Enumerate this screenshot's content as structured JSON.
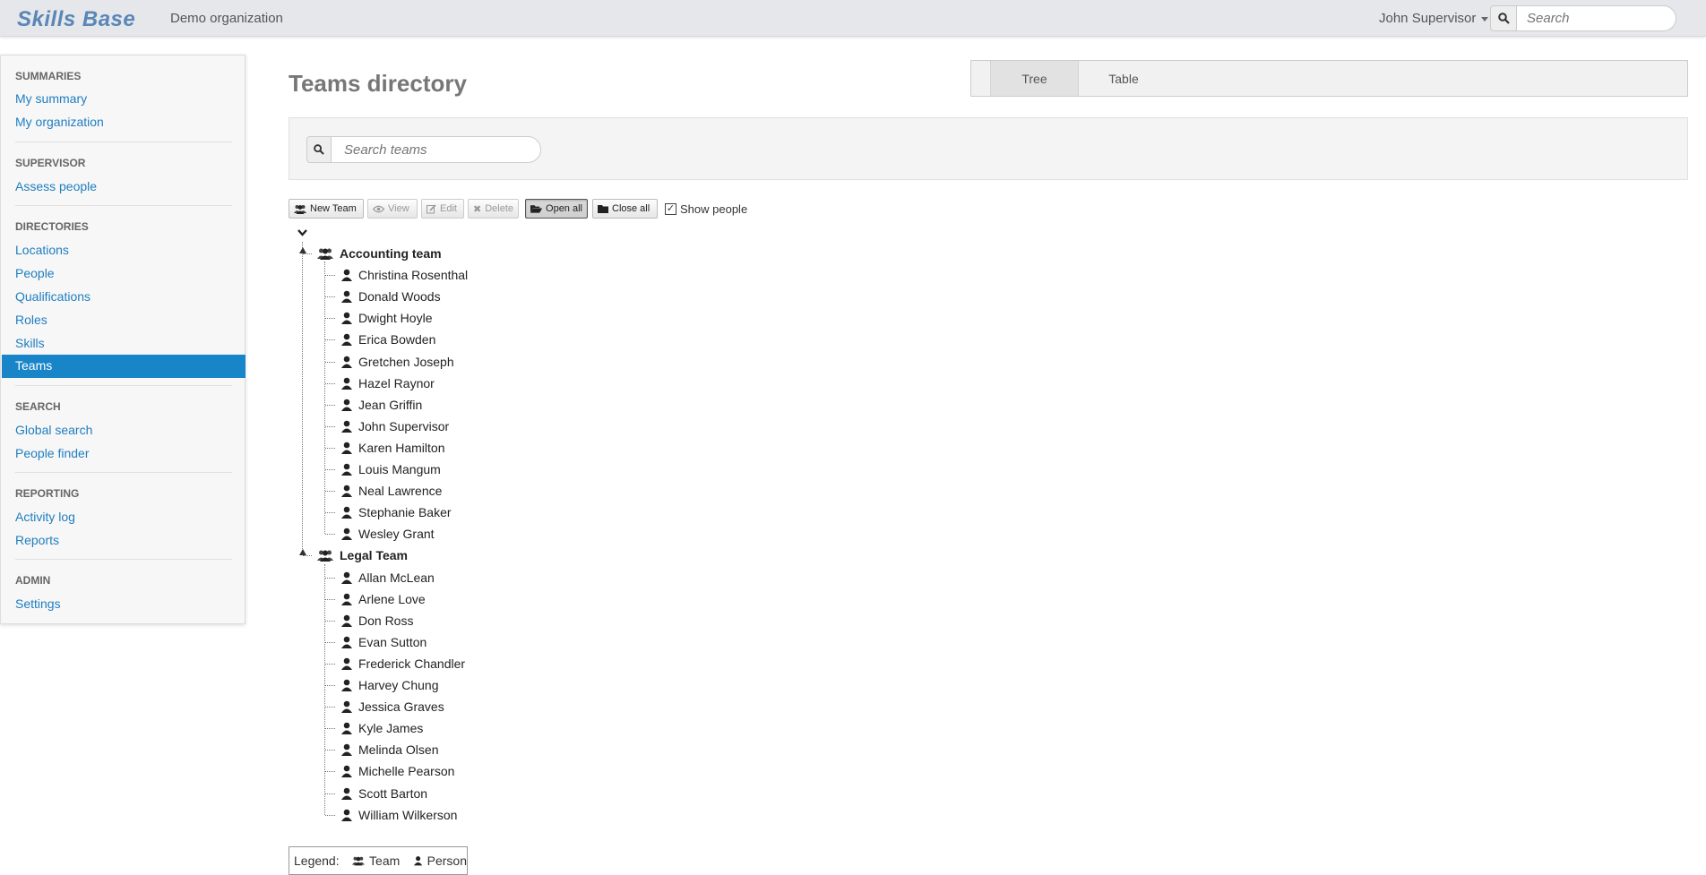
{
  "app": {
    "brand": "Skills Base",
    "org": "Demo organization"
  },
  "topbar": {
    "user": "John Supervisor",
    "search_placeholder": "Search"
  },
  "sidebar": {
    "sections": [
      {
        "heading": "Summaries",
        "items": [
          "My summary",
          "My organization"
        ]
      },
      {
        "heading": "Supervisor",
        "items": [
          "Assess people"
        ]
      },
      {
        "heading": "Directories",
        "items": [
          "Locations",
          "People",
          "Qualifications",
          "Roles",
          "Skills",
          "Teams"
        ]
      },
      {
        "heading": "Search",
        "items": [
          "Global search",
          "People finder"
        ]
      },
      {
        "heading": "Reporting",
        "items": [
          "Activity log",
          "Reports"
        ]
      },
      {
        "heading": "Admin",
        "items": [
          "Settings"
        ]
      }
    ],
    "active_item": "Teams"
  },
  "main": {
    "title": "Teams directory",
    "view_tabs": [
      "Tree",
      "Table"
    ],
    "active_tab": "Tree",
    "team_search_placeholder": "Search teams"
  },
  "toolbar": {
    "new_team": "New Team",
    "view": "View",
    "edit": "Edit",
    "delete": "Delete",
    "open_all": "Open all",
    "close_all": "Close all",
    "show_people": "Show people",
    "show_people_checked": true
  },
  "tree": {
    "teams": [
      {
        "name": "Accounting team",
        "people": [
          "Christina Rosenthal",
          "Donald Woods",
          "Dwight Hoyle",
          "Erica Bowden",
          "Gretchen Joseph",
          "Hazel Raynor",
          "Jean Griffin",
          "John Supervisor",
          "Karen Hamilton",
          "Louis Mangum",
          "Neal Lawrence",
          "Stephanie Baker",
          "Wesley Grant"
        ]
      },
      {
        "name": "Legal Team",
        "people": [
          "Allan McLean",
          "Arlene Love",
          "Don Ross",
          "Evan Sutton",
          "Frederick Chandler",
          "Harvey Chung",
          "Jessica Graves",
          "Kyle James",
          "Melinda Olsen",
          "Michelle Pearson",
          "Scott Barton",
          "William Wilkerson"
        ]
      }
    ]
  },
  "legend": {
    "label": "Legend:",
    "team": "Team",
    "person": "Person"
  },
  "icons": {
    "team": "team-icon",
    "person": "person-icon",
    "search": "search-icon"
  }
}
